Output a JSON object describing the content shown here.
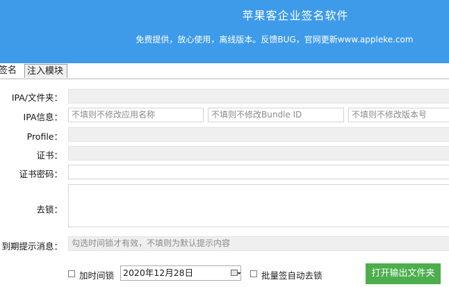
{
  "header": {
    "title": "苹果客企业签名软件",
    "subtitle": "免费提供，放心使用，离线版本。反馈BUG，官网更新www.appleke.com"
  },
  "tabs": {
    "sign": "签名",
    "inject": "注入模块"
  },
  "form": {
    "ipa_folder": {
      "label": "IPA/文件夹：",
      "value": ""
    },
    "ipa_info": {
      "label": "IPA信息：",
      "app_name_placeholder": "不填则不修改应用名称",
      "bundle_id_placeholder": "不填则不修改Bundle ID",
      "version_placeholder": "不填则不修改版本号"
    },
    "profile": {
      "label": "Profile：",
      "value": ""
    },
    "certificate": {
      "label": "证书：",
      "value": ""
    },
    "cert_password": {
      "label": "证书密码：",
      "value": ""
    },
    "unlock": {
      "label": "去锁：",
      "value": ""
    },
    "expiry_message": {
      "label": "到期提示消息：",
      "placeholder": "勾选时间锁才有效，不填则为默认提示内容"
    }
  },
  "footer": {
    "time_lock_label": "加时间锁",
    "time_lock_checked": false,
    "date_value": "2020年12月28日",
    "batch_unlock_label": "批量签自动去锁",
    "batch_unlock_checked": false,
    "open_output_button": "打开输出文件夹"
  },
  "colors": {
    "header_bg": "#3d9be9",
    "button_green": "#4cae4c"
  }
}
